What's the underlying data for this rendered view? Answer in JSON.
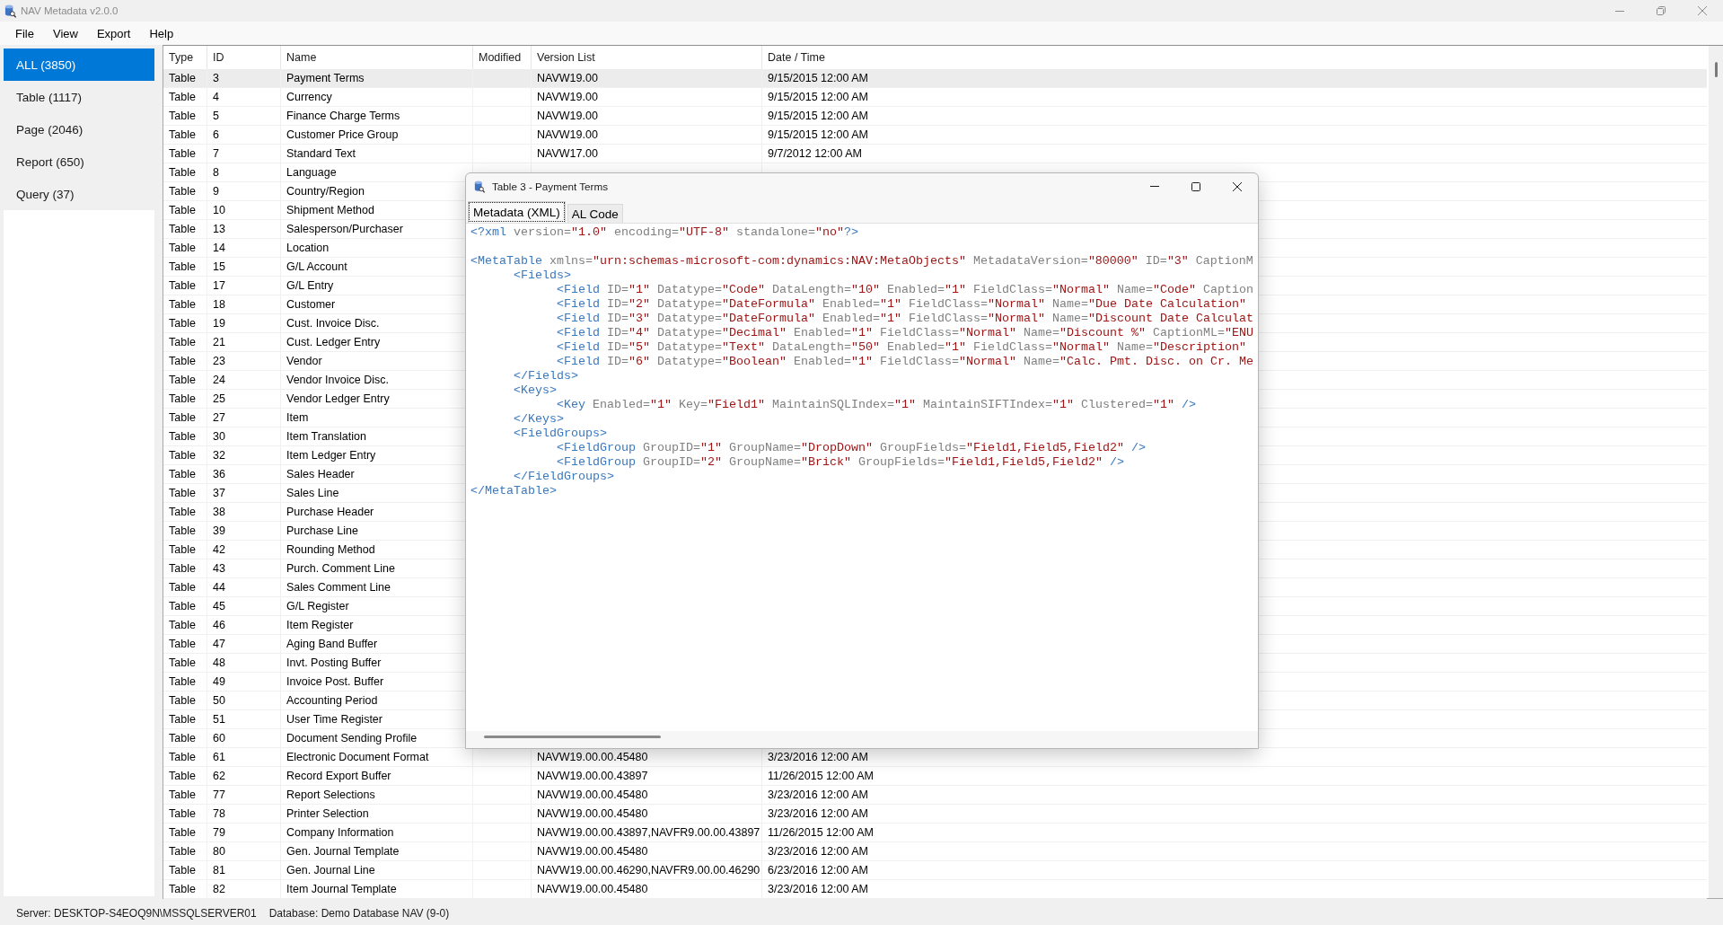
{
  "window": {
    "title": "NAV Metadata v2.0.0"
  },
  "menu": [
    "File",
    "View",
    "Export",
    "Help"
  ],
  "sidebar": {
    "items": [
      {
        "label": "ALL (3850)",
        "selected": true
      },
      {
        "label": "Table (1117)",
        "selected": false
      },
      {
        "label": "Page (2046)",
        "selected": false
      },
      {
        "label": "Report (650)",
        "selected": false
      },
      {
        "label": "Query (37)",
        "selected": false
      }
    ]
  },
  "table": {
    "columns": [
      "Type",
      "ID",
      "Name",
      "Modified",
      "Version List",
      "Date / Time"
    ],
    "rows": [
      {
        "type": "Table",
        "id": "3",
        "name": "Payment Terms",
        "version": "NAVW19.00",
        "date": "9/15/2015 12:00 AM",
        "selected": true
      },
      {
        "type": "Table",
        "id": "4",
        "name": "Currency",
        "version": "NAVW19.00",
        "date": "9/15/2015 12:00 AM",
        "selected": false
      },
      {
        "type": "Table",
        "id": "5",
        "name": "Finance Charge Terms",
        "version": "NAVW19.00",
        "date": "9/15/2015 12:00 AM",
        "selected": false
      },
      {
        "type": "Table",
        "id": "6",
        "name": "Customer Price Group",
        "version": "NAVW19.00",
        "date": "9/15/2015 12:00 AM",
        "selected": false
      },
      {
        "type": "Table",
        "id": "7",
        "name": "Standard Text",
        "version": "NAVW17.00",
        "date": "9/7/2012 12:00 AM",
        "selected": false
      },
      {
        "type": "Table",
        "id": "8",
        "name": "Language",
        "selected": false
      },
      {
        "type": "Table",
        "id": "9",
        "name": "Country/Region",
        "selected": false
      },
      {
        "type": "Table",
        "id": "10",
        "name": "Shipment Method",
        "selected": false
      },
      {
        "type": "Table",
        "id": "13",
        "name": "Salesperson/Purchaser",
        "selected": false
      },
      {
        "type": "Table",
        "id": "14",
        "name": "Location",
        "selected": false
      },
      {
        "type": "Table",
        "id": "15",
        "name": "G/L Account",
        "selected": false
      },
      {
        "type": "Table",
        "id": "17",
        "name": "G/L Entry",
        "selected": false
      },
      {
        "type": "Table",
        "id": "18",
        "name": "Customer",
        "selected": false
      },
      {
        "type": "Table",
        "id": "19",
        "name": "Cust. Invoice Disc.",
        "selected": false
      },
      {
        "type": "Table",
        "id": "21",
        "name": "Cust. Ledger Entry",
        "selected": false
      },
      {
        "type": "Table",
        "id": "23",
        "name": "Vendor",
        "selected": false
      },
      {
        "type": "Table",
        "id": "24",
        "name": "Vendor Invoice Disc.",
        "selected": false
      },
      {
        "type": "Table",
        "id": "25",
        "name": "Vendor Ledger Entry",
        "selected": false
      },
      {
        "type": "Table",
        "id": "27",
        "name": "Item",
        "selected": false
      },
      {
        "type": "Table",
        "id": "30",
        "name": "Item Translation",
        "selected": false
      },
      {
        "type": "Table",
        "id": "32",
        "name": "Item Ledger Entry",
        "selected": false
      },
      {
        "type": "Table",
        "id": "36",
        "name": "Sales Header",
        "selected": false
      },
      {
        "type": "Table",
        "id": "37",
        "name": "Sales Line",
        "selected": false
      },
      {
        "type": "Table",
        "id": "38",
        "name": "Purchase Header",
        "selected": false
      },
      {
        "type": "Table",
        "id": "39",
        "name": "Purchase Line",
        "selected": false
      },
      {
        "type": "Table",
        "id": "42",
        "name": "Rounding Method",
        "selected": false
      },
      {
        "type": "Table",
        "id": "43",
        "name": "Purch. Comment Line",
        "selected": false
      },
      {
        "type": "Table",
        "id": "44",
        "name": "Sales Comment Line",
        "selected": false
      },
      {
        "type": "Table",
        "id": "45",
        "name": "G/L Register",
        "selected": false
      },
      {
        "type": "Table",
        "id": "46",
        "name": "Item Register",
        "selected": false
      },
      {
        "type": "Table",
        "id": "47",
        "name": "Aging Band Buffer",
        "selected": false
      },
      {
        "type": "Table",
        "id": "48",
        "name": "Invt. Posting Buffer",
        "selected": false
      },
      {
        "type": "Table",
        "id": "49",
        "name": "Invoice Post. Buffer",
        "selected": false
      },
      {
        "type": "Table",
        "id": "50",
        "name": "Accounting Period",
        "selected": false
      },
      {
        "type": "Table",
        "id": "51",
        "name": "User Time Register",
        "selected": false
      },
      {
        "type": "Table",
        "id": "60",
        "name": "Document Sending Profile",
        "selected": false
      },
      {
        "type": "Table",
        "id": "61",
        "name": "Electronic Document Format",
        "version": "NAVW19.00.00.45480",
        "date": "3/23/2016 12:00 AM",
        "selected": false
      },
      {
        "type": "Table",
        "id": "62",
        "name": "Record Export Buffer",
        "version": "NAVW19.00.00.43897",
        "date": "11/26/2015 12:00 AM",
        "selected": false
      },
      {
        "type": "Table",
        "id": "77",
        "name": "Report Selections",
        "version": "NAVW19.00.00.45480",
        "date": "3/23/2016 12:00 AM",
        "selected": false
      },
      {
        "type": "Table",
        "id": "78",
        "name": "Printer Selection",
        "version": "NAVW19.00.00.45480",
        "date": "3/23/2016 12:00 AM",
        "selected": false
      },
      {
        "type": "Table",
        "id": "79",
        "name": "Company Information",
        "version": "NAVW19.00.00.43897,NAVFR9.00.00.43897",
        "date": "11/26/2015 12:00 AM",
        "selected": false
      },
      {
        "type": "Table",
        "id": "80",
        "name": "Gen. Journal Template",
        "version": "NAVW19.00.00.45480",
        "date": "3/23/2016 12:00 AM",
        "selected": false
      },
      {
        "type": "Table",
        "id": "81",
        "name": "Gen. Journal Line",
        "version": "NAVW19.00.00.46290,NAVFR9.00.00.46290",
        "date": "6/23/2016 12:00 AM",
        "selected": false
      },
      {
        "type": "Table",
        "id": "82",
        "name": "Item Journal Template",
        "version": "NAVW19.00.00.45480",
        "date": "3/23/2016 12:00 AM",
        "selected": false
      }
    ]
  },
  "dialog": {
    "title": "Table 3 - Payment Terms",
    "tabs": [
      {
        "label": "Metadata (XML)",
        "selected": true
      },
      {
        "label": "AL Code",
        "selected": false
      }
    ],
    "xml": {
      "prolog": [
        {
          "kind": "tag",
          "text": "<?xml"
        },
        {
          "kind": "attr",
          "text": " version="
        },
        {
          "kind": "value",
          "text": "\"1.0\""
        },
        {
          "kind": "attr",
          "text": " encoding="
        },
        {
          "kind": "value",
          "text": "\"UTF-8\""
        },
        {
          "kind": "attr",
          "text": " standalone="
        },
        {
          "kind": "value",
          "text": "\"no\""
        },
        {
          "kind": "tag",
          "text": "?>"
        }
      ],
      "lines": [
        {
          "tokens": [
            {
              "kind": "tag",
              "text": "<MetaTable"
            },
            {
              "kind": "attr",
              "text": " xmlns="
            },
            {
              "kind": "value",
              "text": "\"urn:schemas-microsoft-com:dynamics:NAV:MetaObjects\""
            },
            {
              "kind": "attr",
              "text": " MetadataVersion="
            },
            {
              "kind": "value",
              "text": "\"80000\""
            },
            {
              "kind": "attr",
              "text": " ID="
            },
            {
              "kind": "value",
              "text": "\"3\""
            },
            {
              "kind": "attr",
              "text": " CaptionM"
            }
          ],
          "children": [
            {
              "tokens": [
                {
                  "kind": "tag",
                  "text": "<Fields>"
                }
              ],
              "children": [
                {
                  "tokens": [
                    {
                      "kind": "tag",
                      "text": "<Field"
                    },
                    {
                      "kind": "attr",
                      "text": " ID="
                    },
                    {
                      "kind": "value",
                      "text": "\"1\""
                    },
                    {
                      "kind": "attr",
                      "text": " Datatype="
                    },
                    {
                      "kind": "value",
                      "text": "\"Code\""
                    },
                    {
                      "kind": "attr",
                      "text": " DataLength="
                    },
                    {
                      "kind": "value",
                      "text": "\"10\""
                    },
                    {
                      "kind": "attr",
                      "text": " Enabled="
                    },
                    {
                      "kind": "value",
                      "text": "\"1\""
                    },
                    {
                      "kind": "attr",
                      "text": " FieldClass="
                    },
                    {
                      "kind": "value",
                      "text": "\"Normal\""
                    },
                    {
                      "kind": "attr",
                      "text": " Name="
                    },
                    {
                      "kind": "value",
                      "text": "\"Code\""
                    },
                    {
                      "kind": "attr",
                      "text": " Caption"
                    }
                  ]
                },
                {
                  "tokens": [
                    {
                      "kind": "tag",
                      "text": "<Field"
                    },
                    {
                      "kind": "attr",
                      "text": " ID="
                    },
                    {
                      "kind": "value",
                      "text": "\"2\""
                    },
                    {
                      "kind": "attr",
                      "text": " Datatype="
                    },
                    {
                      "kind": "value",
                      "text": "\"DateFormula\""
                    },
                    {
                      "kind": "attr",
                      "text": " Enabled="
                    },
                    {
                      "kind": "value",
                      "text": "\"1\""
                    },
                    {
                      "kind": "attr",
                      "text": " FieldClass="
                    },
                    {
                      "kind": "value",
                      "text": "\"Normal\""
                    },
                    {
                      "kind": "attr",
                      "text": " Name="
                    },
                    {
                      "kind": "value",
                      "text": "\"Due Date Calculation\""
                    }
                  ]
                },
                {
                  "tokens": [
                    {
                      "kind": "tag",
                      "text": "<Field"
                    },
                    {
                      "kind": "attr",
                      "text": " ID="
                    },
                    {
                      "kind": "value",
                      "text": "\"3\""
                    },
                    {
                      "kind": "attr",
                      "text": " Datatype="
                    },
                    {
                      "kind": "value",
                      "text": "\"DateFormula\""
                    },
                    {
                      "kind": "attr",
                      "text": " Enabled="
                    },
                    {
                      "kind": "value",
                      "text": "\"1\""
                    },
                    {
                      "kind": "attr",
                      "text": " FieldClass="
                    },
                    {
                      "kind": "value",
                      "text": "\"Normal\""
                    },
                    {
                      "kind": "attr",
                      "text": " Name="
                    },
                    {
                      "kind": "value",
                      "text": "\"Discount Date Calculat"
                    }
                  ]
                },
                {
                  "tokens": [
                    {
                      "kind": "tag",
                      "text": "<Field"
                    },
                    {
                      "kind": "attr",
                      "text": " ID="
                    },
                    {
                      "kind": "value",
                      "text": "\"4\""
                    },
                    {
                      "kind": "attr",
                      "text": " Datatype="
                    },
                    {
                      "kind": "value",
                      "text": "\"Decimal\""
                    },
                    {
                      "kind": "attr",
                      "text": " Enabled="
                    },
                    {
                      "kind": "value",
                      "text": "\"1\""
                    },
                    {
                      "kind": "attr",
                      "text": " FieldClass="
                    },
                    {
                      "kind": "value",
                      "text": "\"Normal\""
                    },
                    {
                      "kind": "attr",
                      "text": " Name="
                    },
                    {
                      "kind": "value",
                      "text": "\"Discount %\""
                    },
                    {
                      "kind": "attr",
                      "text": " CaptionML="
                    },
                    {
                      "kind": "value",
                      "text": "\"ENU"
                    }
                  ]
                },
                {
                  "tokens": [
                    {
                      "kind": "tag",
                      "text": "<Field"
                    },
                    {
                      "kind": "attr",
                      "text": " ID="
                    },
                    {
                      "kind": "value",
                      "text": "\"5\""
                    },
                    {
                      "kind": "attr",
                      "text": " Datatype="
                    },
                    {
                      "kind": "value",
                      "text": "\"Text\""
                    },
                    {
                      "kind": "attr",
                      "text": " DataLength="
                    },
                    {
                      "kind": "value",
                      "text": "\"50\""
                    },
                    {
                      "kind": "attr",
                      "text": " Enabled="
                    },
                    {
                      "kind": "value",
                      "text": "\"1\""
                    },
                    {
                      "kind": "attr",
                      "text": " FieldClass="
                    },
                    {
                      "kind": "value",
                      "text": "\"Normal\""
                    },
                    {
                      "kind": "attr",
                      "text": " Name="
                    },
                    {
                      "kind": "value",
                      "text": "\"Description\""
                    }
                  ]
                },
                {
                  "tokens": [
                    {
                      "kind": "tag",
                      "text": "<Field"
                    },
                    {
                      "kind": "attr",
                      "text": " ID="
                    },
                    {
                      "kind": "value",
                      "text": "\"6\""
                    },
                    {
                      "kind": "attr",
                      "text": " Datatype="
                    },
                    {
                      "kind": "value",
                      "text": "\"Boolean\""
                    },
                    {
                      "kind": "attr",
                      "text": " Enabled="
                    },
                    {
                      "kind": "value",
                      "text": "\"1\""
                    },
                    {
                      "kind": "attr",
                      "text": " FieldClass="
                    },
                    {
                      "kind": "value",
                      "text": "\"Normal\""
                    },
                    {
                      "kind": "attr",
                      "text": " Name="
                    },
                    {
                      "kind": "value",
                      "text": "\"Calc. Pmt. Disc. on Cr. Me"
                    }
                  ]
                }
              ]
            },
            {
              "tokens": [
                {
                  "kind": "tag",
                  "text": "</Fields>"
                }
              ]
            },
            {
              "tokens": [
                {
                  "kind": "tag",
                  "text": "<Keys>"
                }
              ],
              "children": [
                {
                  "tokens": [
                    {
                      "kind": "tag",
                      "text": "<Key"
                    },
                    {
                      "kind": "attr",
                      "text": " Enabled="
                    },
                    {
                      "kind": "value",
                      "text": "\"1\""
                    },
                    {
                      "kind": "attr",
                      "text": " Key="
                    },
                    {
                      "kind": "value",
                      "text": "\"Field1\""
                    },
                    {
                      "kind": "attr",
                      "text": " MaintainSQLIndex="
                    },
                    {
                      "kind": "value",
                      "text": "\"1\""
                    },
                    {
                      "kind": "attr",
                      "text": " MaintainSIFTIndex="
                    },
                    {
                      "kind": "value",
                      "text": "\"1\""
                    },
                    {
                      "kind": "attr",
                      "text": " Clustered="
                    },
                    {
                      "kind": "value",
                      "text": "\"1\""
                    },
                    {
                      "kind": "tag",
                      "text": " />"
                    }
                  ]
                }
              ]
            },
            {
              "tokens": [
                {
                  "kind": "tag",
                  "text": "</Keys>"
                }
              ]
            },
            {
              "tokens": [
                {
                  "kind": "tag",
                  "text": "<FieldGroups>"
                }
              ],
              "children": [
                {
                  "tokens": [
                    {
                      "kind": "tag",
                      "text": "<FieldGroup"
                    },
                    {
                      "kind": "attr",
                      "text": " GroupID="
                    },
                    {
                      "kind": "value",
                      "text": "\"1\""
                    },
                    {
                      "kind": "attr",
                      "text": " GroupName="
                    },
                    {
                      "kind": "value",
                      "text": "\"DropDown\""
                    },
                    {
                      "kind": "attr",
                      "text": " GroupFields="
                    },
                    {
                      "kind": "value",
                      "text": "\"Field1,Field5,Field2\""
                    },
                    {
                      "kind": "tag",
                      "text": " />"
                    }
                  ]
                },
                {
                  "tokens": [
                    {
                      "kind": "tag",
                      "text": "<FieldGroup"
                    },
                    {
                      "kind": "attr",
                      "text": " GroupID="
                    },
                    {
                      "kind": "value",
                      "text": "\"2\""
                    },
                    {
                      "kind": "attr",
                      "text": " GroupName="
                    },
                    {
                      "kind": "value",
                      "text": "\"Brick\""
                    },
                    {
                      "kind": "attr",
                      "text": " GroupFields="
                    },
                    {
                      "kind": "value",
                      "text": "\"Field1,Field5,Field2\""
                    },
                    {
                      "kind": "tag",
                      "text": " />"
                    }
                  ]
                }
              ]
            },
            {
              "tokens": [
                {
                  "kind": "tag",
                  "text": "</FieldGroups>"
                }
              ]
            }
          ]
        },
        {
          "tokens": [
            {
              "kind": "tag",
              "text": "</MetaTable>"
            }
          ]
        }
      ]
    }
  },
  "status_bar": {
    "server": "Server: DESKTOP-S4EOQ9N\\MSSQLSERVER01",
    "database": "Database: Demo Database NAV (9-0)"
  }
}
